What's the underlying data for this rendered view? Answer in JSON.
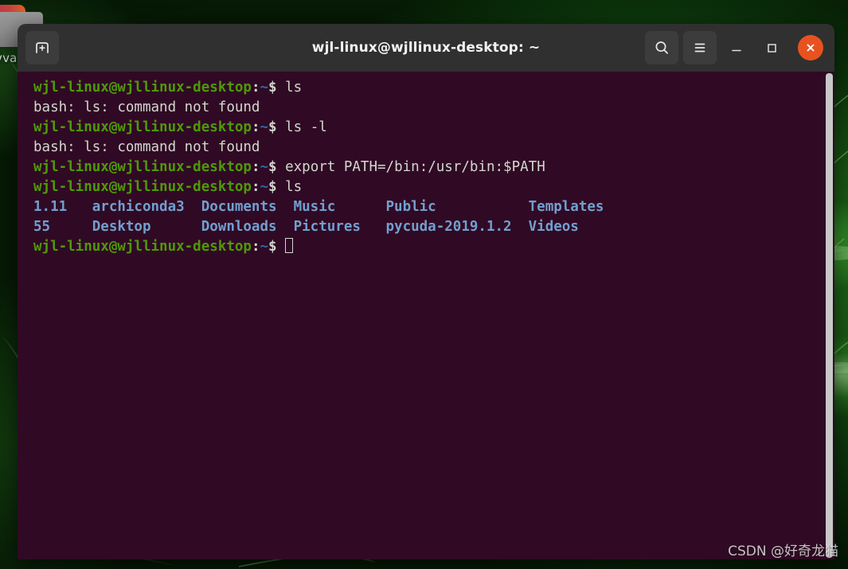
{
  "window": {
    "title": "wjl-linux@wjllinux-desktop: ~",
    "background_color": "#300a24",
    "titlebar_color": "#303030",
    "close_color": "#e8521f",
    "buttons": {
      "new_tab": "new-tab",
      "search": "search",
      "menu": "menu",
      "minimize": "minimize",
      "maximize": "maximize",
      "close": "close"
    }
  },
  "desktop": {
    "icon_label": "vva",
    "watermark": "CSDN @好奇龙猫"
  },
  "terminal": {
    "prompt": "wjl-linux@wjllinux-desktop",
    "prompt_sep": ":",
    "prompt_path": "~",
    "prompt_sym": "$",
    "lines": [
      {
        "type": "prompt",
        "command": " ls"
      },
      {
        "type": "output",
        "text": "bash: ls: command not found"
      },
      {
        "type": "prompt",
        "command": " ls -l"
      },
      {
        "type": "output",
        "text": "bash: ls: command not found"
      },
      {
        "type": "prompt",
        "command": " export PATH=/bin:/usr/bin:$PATH"
      },
      {
        "type": "prompt",
        "command": " ls"
      },
      {
        "type": "listing",
        "items": [
          "1.11",
          "archiconda3",
          "Documents",
          "Music",
          "Public",
          "Templates"
        ]
      },
      {
        "type": "listing",
        "items": [
          "55",
          "Desktop",
          "Downloads",
          "Pictures",
          "pycuda-2019.1.2",
          "Videos"
        ]
      },
      {
        "type": "prompt-cursor",
        "command": " "
      }
    ],
    "listing_line_1": "1.11   archiconda3  Documents  Music      Public           Templates",
    "listing_line_2": "55     Desktop      Downloads  Pictures   pycuda-2019.1.2  Videos",
    "colors": {
      "prompt": "#4e9a06",
      "path": "#3465a4",
      "directory": "#729fcf",
      "text": "#d3d7cf"
    }
  }
}
